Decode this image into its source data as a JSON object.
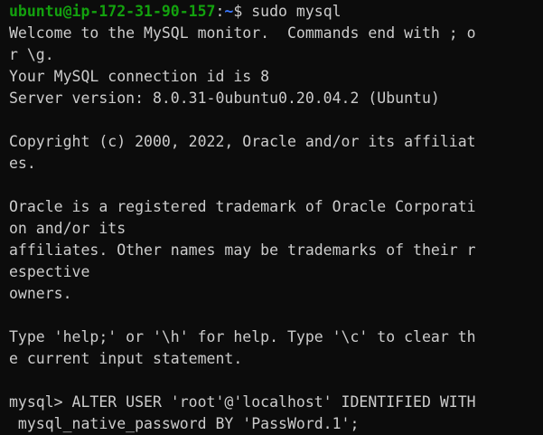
{
  "prompt": {
    "user_host": "ubuntu@ip-172-31-90-157",
    "colon": ":",
    "path": "~",
    "symbol": "$ ",
    "command": "sudo mysql"
  },
  "output": [
    "Welcome to the MySQL monitor.  Commands end with ; o",
    "r \\g.",
    "Your MySQL connection id is 8",
    "Server version: 8.0.31-0ubuntu0.20.04.2 (Ubuntu)",
    "",
    "Copyright (c) 2000, 2022, Oracle and/or its affiliat",
    "es.",
    "",
    "Oracle is a registered trademark of Oracle Corporati",
    "on and/or its",
    "affiliates. Other names may be trademarks of their r",
    "espective",
    "owners.",
    "",
    "Type 'help;' or '\\h' for help. Type '\\c' to clear th",
    "e current input statement.",
    "",
    "mysql> ALTER USER 'root'@'localhost' IDENTIFIED WITH",
    " mysql_native_password BY 'PassWord.1';"
  ],
  "colors": {
    "background": "#0c0c0c",
    "text": "#cccccc",
    "user_host": "#13a10e",
    "path": "#3b78ff"
  }
}
